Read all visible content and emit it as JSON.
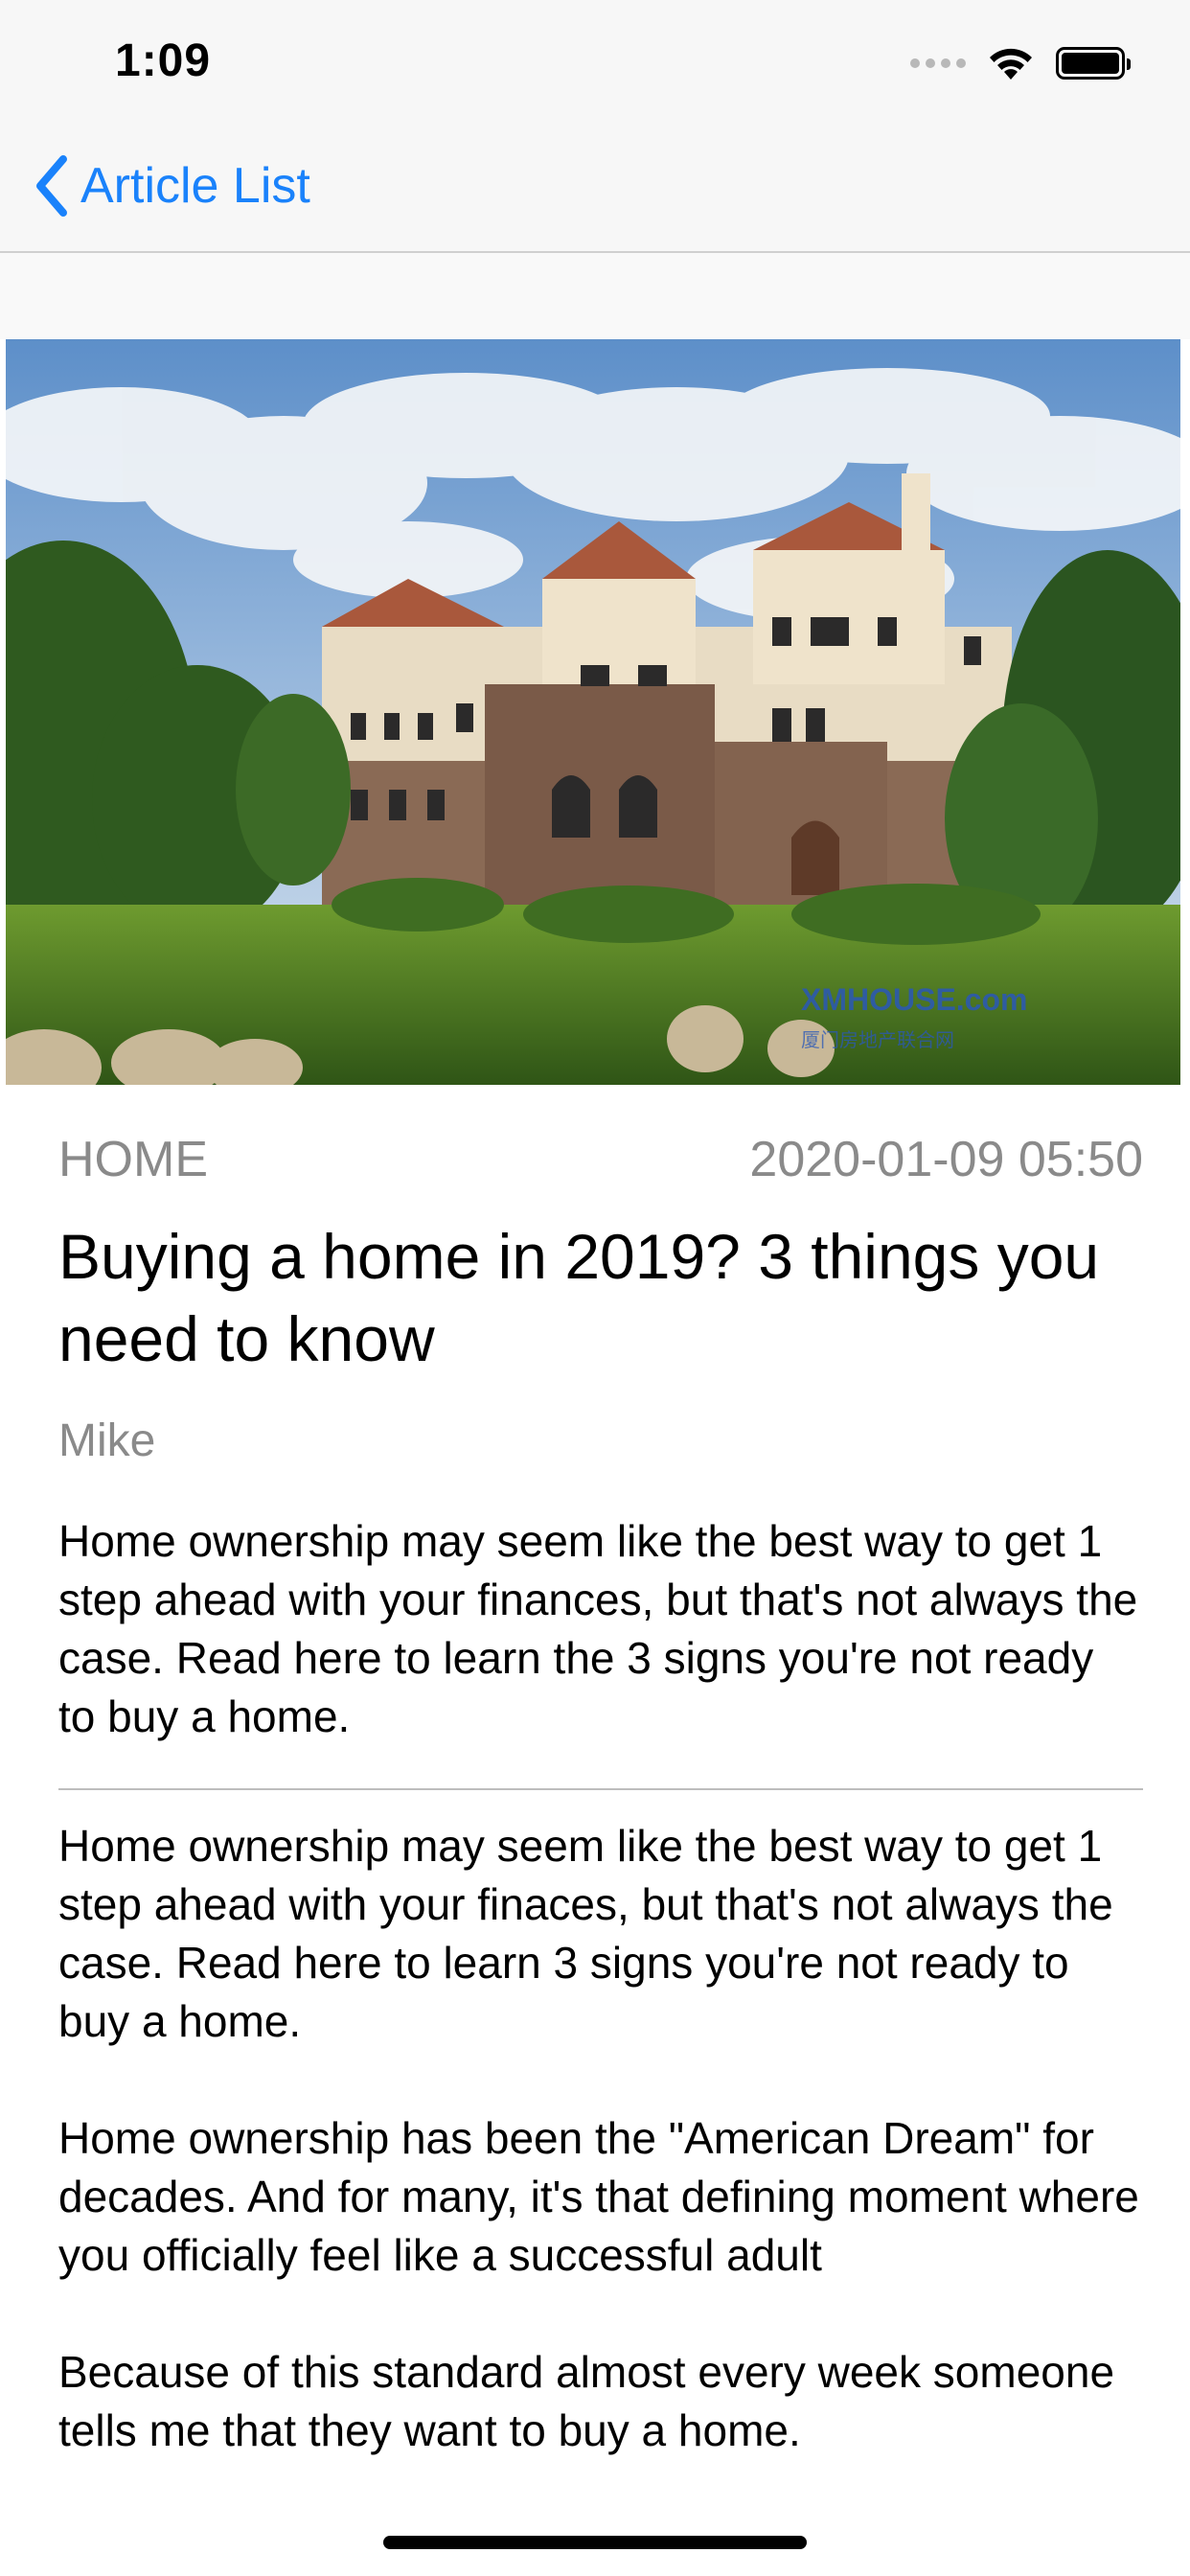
{
  "status_bar": {
    "time": "1:09",
    "icons": [
      "signal-dots-icon",
      "wifi-icon",
      "battery-icon"
    ]
  },
  "nav": {
    "back_label": "Article List",
    "back_icon": "chevron-left-icon"
  },
  "colors": {
    "accent": "#1a82fb",
    "meta_gray": "#8a8a8a",
    "text": "#000000"
  },
  "hero": {
    "watermark": "XMHOUSE.com",
    "watermark_sub": "厦门房地产联合网"
  },
  "article": {
    "category": "HOME",
    "date": "2020-01-09 05:50",
    "title": "Buying a home in 2019? 3 things you need to know",
    "author": "Mike",
    "summary": "Home ownership may seem like the best way to get 1 step ahead with your finances, but that's not always the case. Read here to learn the 3 signs you're not ready to buy a home.",
    "paragraphs": [
      "Home ownership may seem like the best way to get 1 step ahead with your finaces, but that's not always the case. Read here to learn 3 signs you're not ready to buy a home.",
      "Home ownership has been the \"American Dream\" for decades. And for many, it's that defining moment where you officially feel like a successful adult",
      "Because of this standard almost every week someone tells me that they want to buy a home."
    ]
  }
}
